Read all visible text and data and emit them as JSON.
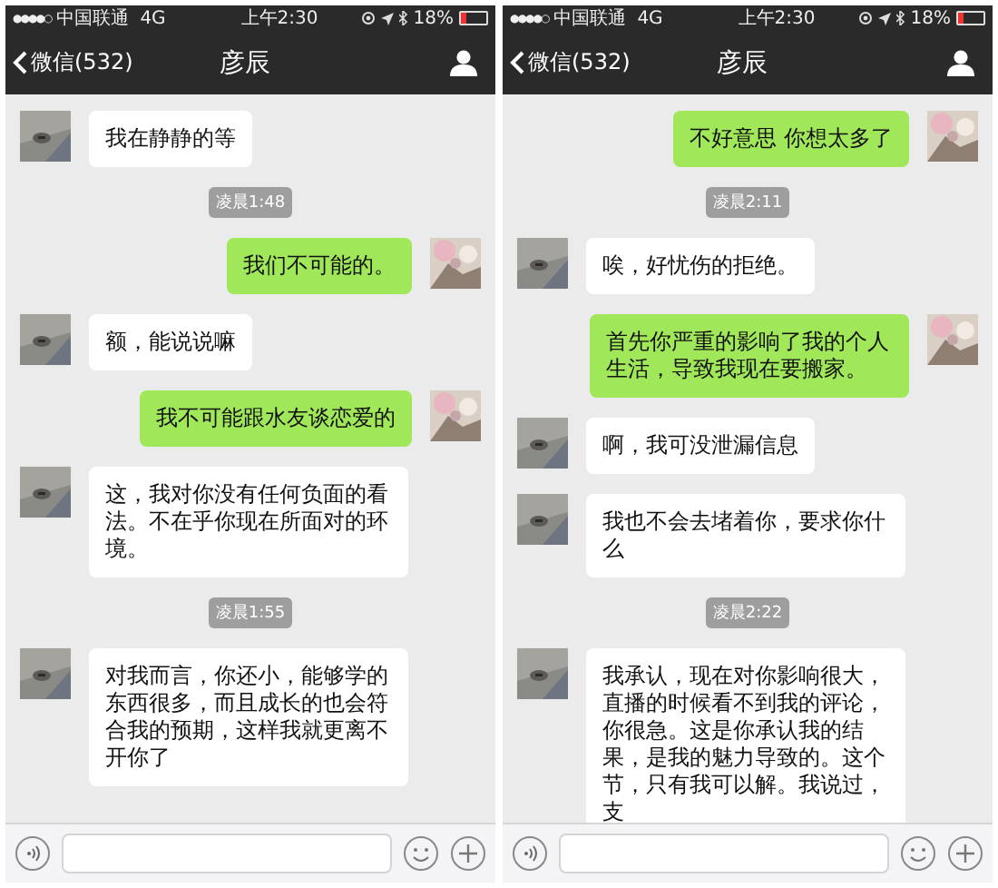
{
  "phones": [
    {
      "status": {
        "signal": "●●●●○",
        "carrier": "中国联通",
        "network": "4G",
        "time": "上午2:30",
        "battery": "18%"
      },
      "nav": {
        "back": "微信(532)",
        "title": "彦辰"
      },
      "messages": [
        {
          "kind": "in",
          "text": "我在静静的等"
        },
        {
          "kind": "time",
          "text": "凌晨1:48"
        },
        {
          "kind": "out",
          "text": "我们不可能的。"
        },
        {
          "kind": "in",
          "text": "额，能说说嘛"
        },
        {
          "kind": "out",
          "text": "我不可能跟水友谈恋爱的"
        },
        {
          "kind": "in",
          "text": "这，我对你没有任何负面的看法。不在乎你现在所面对的环境。"
        },
        {
          "kind": "time",
          "text": "凌晨1:55"
        },
        {
          "kind": "in",
          "text": "对我而言，你还小，能够学的东西很多，而且成长的也会符合我的预期，这样我就更离不开你了"
        }
      ]
    },
    {
      "status": {
        "signal": "●●●●○",
        "carrier": "中国联通",
        "network": "4G",
        "time": "上午2:30",
        "battery": "18%"
      },
      "nav": {
        "back": "微信(532)",
        "title": "彦辰"
      },
      "messages": [
        {
          "kind": "out",
          "text": "不好意思 你想太多了"
        },
        {
          "kind": "time",
          "text": "凌晨2:11"
        },
        {
          "kind": "in",
          "text": "唉，好忧伤的拒绝。"
        },
        {
          "kind": "out",
          "text": "首先你严重的影响了我的个人生活，导致我现在要搬家。"
        },
        {
          "kind": "in",
          "text": "啊，我可没泄漏信息"
        },
        {
          "kind": "in",
          "text": "我也不会去堵着你，要求你什么"
        },
        {
          "kind": "time",
          "text": "凌晨2:22"
        },
        {
          "kind": "in",
          "text": "我承认，现在对你影响很大，直播的时候看不到我的评论，你很急。这是你承认我的结果，是我的魅力导致的。这个节，只有我可以解。我说过，支"
        }
      ]
    }
  ]
}
